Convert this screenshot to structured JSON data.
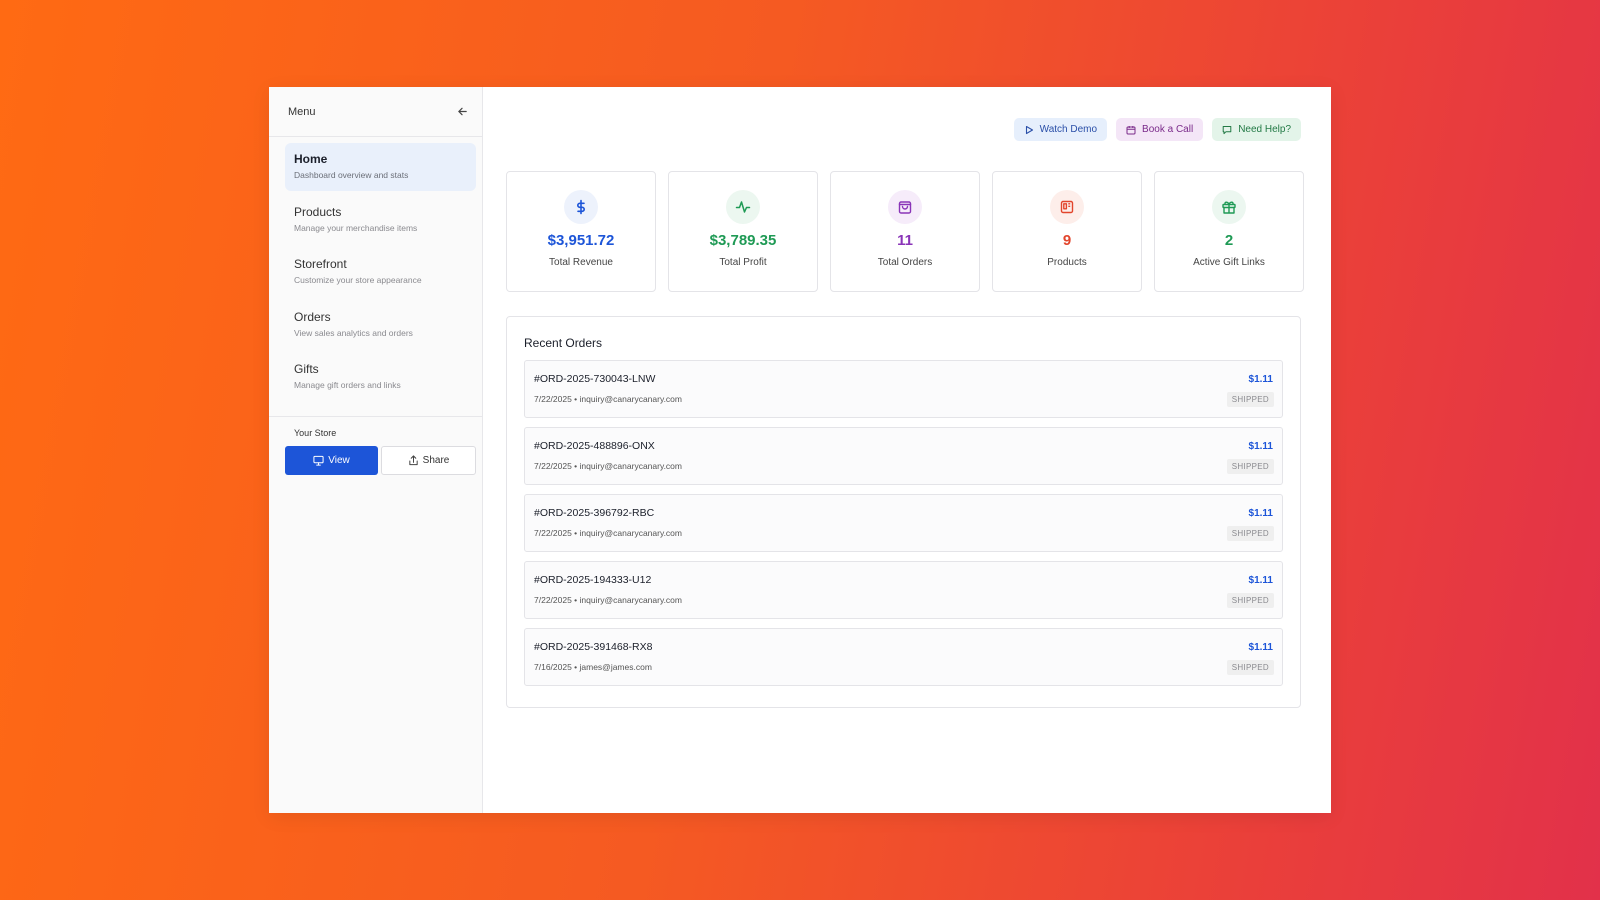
{
  "sidebar": {
    "title": "Menu",
    "items": [
      {
        "label": "Home",
        "desc": "Dashboard overview and stats"
      },
      {
        "label": "Products",
        "desc": "Manage your merchandise items"
      },
      {
        "label": "Storefront",
        "desc": "Customize your store appearance"
      },
      {
        "label": "Orders",
        "desc": "View sales analytics and orders"
      },
      {
        "label": "Gifts",
        "desc": "Manage gift orders and links"
      }
    ],
    "store_title": "Your Store",
    "view_label": "View",
    "share_label": "Share"
  },
  "top_actions": {
    "watch_demo": "Watch Demo",
    "book_call": "Book a Call",
    "need_help": "Need Help?"
  },
  "stats": [
    {
      "value": "$3,951.72",
      "label": "Total Revenue",
      "icon": "dollar-icon",
      "color": "#1d55d8"
    },
    {
      "value": "$3,789.35",
      "label": "Total Profit",
      "icon": "activity-icon",
      "color": "#1f9a55"
    },
    {
      "value": "11",
      "label": "Total Orders",
      "icon": "shopping-bag-icon",
      "color": "#8a35b8"
    },
    {
      "value": "9",
      "label": "Products",
      "icon": "product-icon",
      "color": "#e2452c"
    },
    {
      "value": "2",
      "label": "Active Gift Links",
      "icon": "gift-icon",
      "color": "#1f9a55"
    }
  ],
  "recent_orders": {
    "title": "Recent Orders",
    "rows": [
      {
        "id": "#ORD-2025-730043-LNW",
        "meta": "7/22/2025 • inquiry@canarycanary.com",
        "amount": "$1.11",
        "status": "SHIPPED"
      },
      {
        "id": "#ORD-2025-488896-ONX",
        "meta": "7/22/2025 • inquiry@canarycanary.com",
        "amount": "$1.11",
        "status": "SHIPPED"
      },
      {
        "id": "#ORD-2025-396792-RBC",
        "meta": "7/22/2025 • inquiry@canarycanary.com",
        "amount": "$1.11",
        "status": "SHIPPED"
      },
      {
        "id": "#ORD-2025-194333-U12",
        "meta": "7/22/2025 • inquiry@canarycanary.com",
        "amount": "$1.11",
        "status": "SHIPPED"
      },
      {
        "id": "#ORD-2025-391468-RX8",
        "meta": "7/16/2025 • james@james.com",
        "amount": "$1.11",
        "status": "SHIPPED"
      }
    ]
  }
}
